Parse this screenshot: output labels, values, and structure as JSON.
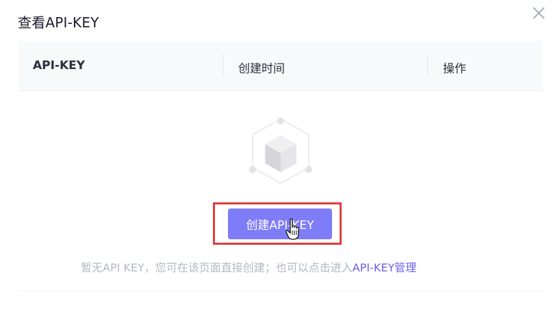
{
  "dialog": {
    "title": "查看API-KEY",
    "close_icon": "close-icon"
  },
  "table": {
    "columns": [
      "API-KEY",
      "创建时间",
      "操作"
    ],
    "rows": []
  },
  "empty_state": {
    "illustration_icon": "empty-box-icon",
    "create_button_label": "创建API-KEY",
    "hint_text": "暂无API KEY，您可在该页面直接创建；也可以点击进入",
    "hint_link": "API-KEY管理"
  },
  "colors": {
    "accent": "#7f7cf7",
    "link": "#6a62e6",
    "highlight_border": "#e23b3b",
    "header_bg": "#f7fafb"
  }
}
